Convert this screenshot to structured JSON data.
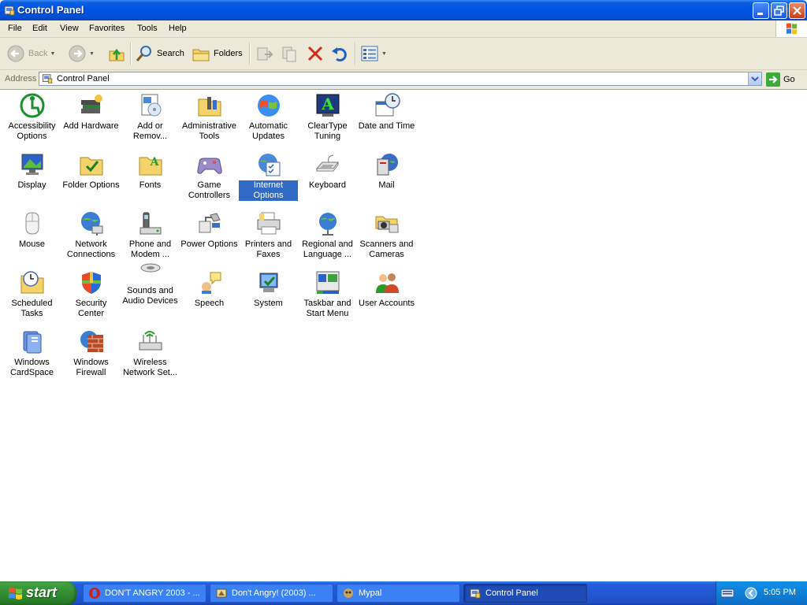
{
  "window": {
    "title": "Control Panel"
  },
  "menu": [
    "File",
    "Edit",
    "View",
    "Favorites",
    "Tools",
    "Help"
  ],
  "toolbar": {
    "back": "Back",
    "search": "Search",
    "folders": "Folders"
  },
  "address": {
    "label": "Address",
    "value": "Control Panel",
    "go": "Go"
  },
  "items": [
    {
      "label": "Accessibility Options",
      "icon": "accessibility-icon",
      "row": 0,
      "col": 0
    },
    {
      "label": "Add Hardware",
      "icon": "add-hardware-icon",
      "row": 0,
      "col": 1
    },
    {
      "label": "Add or Remov...",
      "icon": "add-remove-programs-icon",
      "row": 0,
      "col": 2
    },
    {
      "label": "Administrative Tools",
      "icon": "administrative-tools-icon",
      "row": 0,
      "col": 3
    },
    {
      "label": "Automatic Updates",
      "icon": "automatic-updates-icon",
      "row": 0,
      "col": 4
    },
    {
      "label": "ClearType Tuning",
      "icon": "cleartype-icon",
      "row": 0,
      "col": 5
    },
    {
      "label": "Date and Time",
      "icon": "date-time-icon",
      "row": 0,
      "col": 6
    },
    {
      "label": "Display",
      "icon": "display-icon",
      "row": 1,
      "col": 0
    },
    {
      "label": "Folder Options",
      "icon": "folder-options-icon",
      "row": 1,
      "col": 1
    },
    {
      "label": "Fonts",
      "icon": "fonts-icon",
      "row": 1,
      "col": 2
    },
    {
      "label": "Game Controllers",
      "icon": "game-controllers-icon",
      "row": 1,
      "col": 3
    },
    {
      "label": "Internet Options",
      "icon": "internet-options-icon",
      "row": 1,
      "col": 4,
      "selected": true
    },
    {
      "label": "Keyboard",
      "icon": "keyboard-icon",
      "row": 1,
      "col": 5
    },
    {
      "label": "Mail",
      "icon": "mail-icon",
      "row": 1,
      "col": 6
    },
    {
      "label": "Mouse",
      "icon": "mouse-icon",
      "row": 2,
      "col": 0
    },
    {
      "label": "Network Connections",
      "icon": "network-icon",
      "row": 2,
      "col": 1
    },
    {
      "label": "Phone and Modem ...",
      "icon": "phone-modem-icon",
      "row": 2,
      "col": 2
    },
    {
      "label": "Power Options",
      "icon": "power-options-icon",
      "row": 2,
      "col": 3
    },
    {
      "label": "Printers and Faxes",
      "icon": "printers-icon",
      "row": 2,
      "col": 4
    },
    {
      "label": "Regional and Language ...",
      "icon": "regional-icon",
      "row": 2,
      "col": 5
    },
    {
      "label": "Scanners and Cameras",
      "icon": "scanners-icon",
      "row": 2,
      "col": 6
    },
    {
      "label": "Scheduled Tasks",
      "icon": "scheduled-tasks-icon",
      "row": 3,
      "col": 0
    },
    {
      "label": "Security Center",
      "icon": "security-center-icon",
      "row": 3,
      "col": 1
    },
    {
      "label": "Sounds and Audio Devices",
      "icon": "sounds-icon",
      "row": 3,
      "col": 2
    },
    {
      "label": "Speech",
      "icon": "speech-icon",
      "row": 3,
      "col": 3
    },
    {
      "label": "System",
      "icon": "system-icon",
      "row": 3,
      "col": 4
    },
    {
      "label": "Taskbar and Start Menu",
      "icon": "taskbar-icon",
      "row": 3,
      "col": 5
    },
    {
      "label": "User Accounts",
      "icon": "user-accounts-icon",
      "row": 3,
      "col": 6
    },
    {
      "label": "Windows CardSpace",
      "icon": "cardspace-icon",
      "row": 4,
      "col": 0
    },
    {
      "label": "Windows Firewall",
      "icon": "firewall-icon",
      "row": 4,
      "col": 1
    },
    {
      "label": "Wireless Network Set...",
      "icon": "wireless-icon",
      "row": 4,
      "col": 2
    }
  ],
  "taskbar": {
    "start": "start",
    "tasks": [
      {
        "label": "DON'T ANGRY 2003 - ...",
        "icon": "opera-icon"
      },
      {
        "label": "Don't Angry! (2003) ...",
        "icon": "app-icon"
      },
      {
        "label": "Mypal",
        "icon": "mypal-icon"
      },
      {
        "label": "Control Panel",
        "icon": "control-panel-icon",
        "active": true
      }
    ],
    "clock": "5:05 PM"
  }
}
